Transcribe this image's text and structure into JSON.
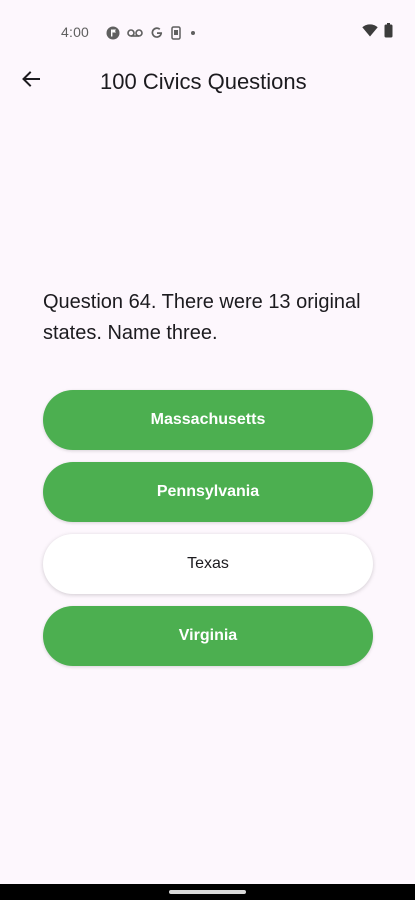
{
  "status_bar": {
    "time": "4:00",
    "left_icons": [
      "flag-circle-icon",
      "voicemail-icon",
      "google-g-icon",
      "phone-device-icon",
      "dot-icon"
    ],
    "right_icons": [
      "wifi-icon",
      "battery-icon"
    ]
  },
  "app_bar": {
    "title": "100 Civics Questions",
    "back_icon": "arrow-left-icon"
  },
  "question": {
    "text": "Question 64. There were 13 original states. Name three."
  },
  "answers": [
    {
      "label": "Massachusetts",
      "state": "correct"
    },
    {
      "label": "Pennsylvania",
      "state": "correct"
    },
    {
      "label": "Texas",
      "state": "neutral"
    },
    {
      "label": "Virginia",
      "state": "correct"
    }
  ],
  "colors": {
    "background": "#fdf7fd",
    "correct": "#4caf50",
    "neutral": "#ffffff",
    "text": "#1c1b1f"
  }
}
